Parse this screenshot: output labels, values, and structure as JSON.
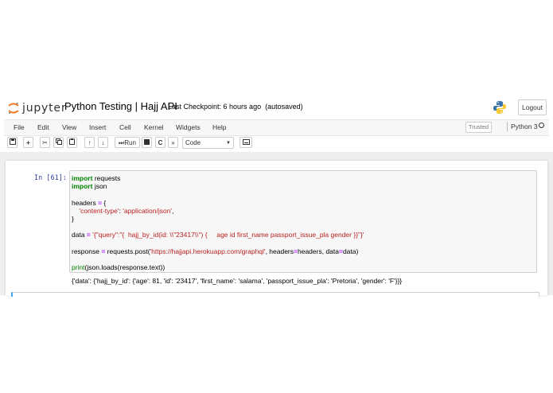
{
  "header": {
    "logo_text": "jupyter",
    "notebook_title": "Python Testing | Hajj API",
    "checkpoint": "Last Checkpoint: 6 hours ago",
    "autosave": "(autosaved)",
    "logout_label": "Logout"
  },
  "menu": {
    "items": [
      "File",
      "Edit",
      "View",
      "Insert",
      "Cell",
      "Kernel",
      "Widgets",
      "Help"
    ],
    "trusted": "Trusted",
    "kernel": "Python 3"
  },
  "toolbar": {
    "run_label": "Run",
    "cell_type": "Code"
  },
  "cell": {
    "prompt": "In [61]:",
    "code": {
      "kw_import": "import",
      "line1_mod": " requests",
      "line2_mod": " json",
      "line4_a": "headers ",
      "eq": "=",
      "line4_b": " {",
      "line5_key": "'content-type'",
      "line5_colon": ": ",
      "line5_val": "'application/json'",
      "line5_end": ",",
      "line6": "}",
      "line8_a": "data ",
      "line8_str": "'{\"query\":\"{  hajj_by_id(id: \\\\\"23417\\\\\") {     age id first_name passport_issue_pla gender }}\"}'",
      "line10_a": "response ",
      "line10_b": " requests.post(",
      "line10_url": "'https://hajjapi.herokuapp.com/graphql'",
      "line10_c": ", headers",
      "line10_d": "headers, data",
      "line10_e": "data)",
      "line12_print": "print",
      "line12_rest": "(json.loads(response.text))"
    },
    "output": "{'data': {'hajj_by_id': {'age': 81, 'id': '23417', 'first_name': 'salama', 'passport_issue_pla': 'Pretoria', 'gender': 'F'}}}"
  }
}
